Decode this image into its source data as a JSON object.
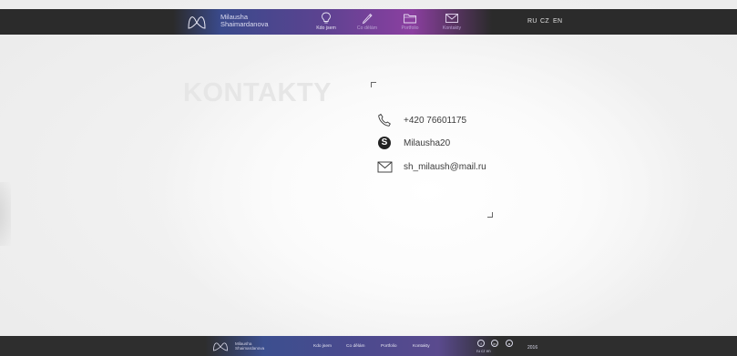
{
  "header": {
    "brand_line1": "Milausha",
    "brand_line2": "Shaimardanova",
    "nav": [
      {
        "label": "Kdo jsem",
        "icon": "lightbulb-icon",
        "active": true
      },
      {
        "label": "Co dělám",
        "icon": "pencil-icon",
        "active": false
      },
      {
        "label": "Portfolio",
        "icon": "folder-icon",
        "active": false
      },
      {
        "label": "Kontakty",
        "icon": "envelope-icon",
        "active": false
      }
    ],
    "languages": [
      "RU",
      "CZ",
      "EN"
    ]
  },
  "main": {
    "title": "KONTAKTY",
    "contacts": [
      {
        "icon": "phone-icon",
        "text": "+420 76601175"
      },
      {
        "icon": "skype-icon",
        "text": "Milausha20"
      },
      {
        "icon": "envelope-icon",
        "text": "sh_milaush@mail.ru"
      }
    ]
  },
  "footer": {
    "brand_line1": "Milausha",
    "brand_line2": "Shaimardanova",
    "links": [
      "Kdo jsem",
      "Co dělám",
      "Portfolio",
      "Kontakty"
    ],
    "social": [
      {
        "icon": "facebook-icon",
        "glyph": "f"
      },
      {
        "icon": "linkedin-icon",
        "glyph": "in"
      },
      {
        "icon": "instagram-icon",
        "glyph": "●"
      }
    ],
    "languages": "ru  cz  en",
    "year": "2016"
  },
  "colors": {
    "bar": "#2b2b2b",
    "gradient_blue": "#3a4a8c",
    "gradient_purple": "#8b3fa0",
    "title_gray": "#e6e6e6",
    "text_dark": "#3b3b3b"
  }
}
